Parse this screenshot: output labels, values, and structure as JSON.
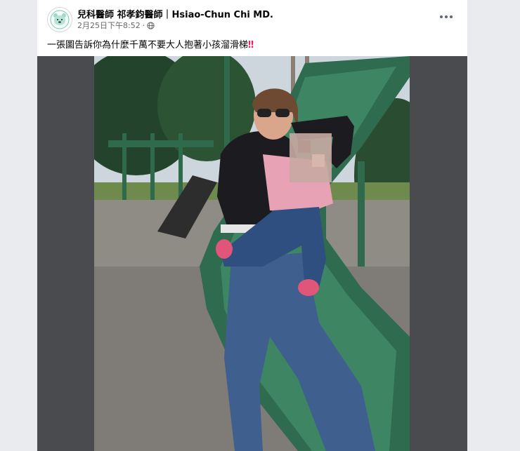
{
  "post": {
    "author": "兒科醫師 祁孝鈞醫師｜Hsiao-Chun Chi MD.",
    "timestamp": "2月25日下午8:52",
    "privacy_separator": "·",
    "audience_icon": "globe-icon",
    "more_icon": "more-options-icon",
    "caption": "一張圖告訴你為什麼千萬不要大人抱著小孩溜滑梯",
    "caption_emoji": "‼",
    "avatar_icon": "bear-avatar-icon",
    "photo_icon": "post-photo"
  },
  "colors": {
    "page_bg": "#e9ebee",
    "card_bg": "#ffffff",
    "media_bg": "#4a4b4f",
    "slide_green": "#2e6b4f",
    "caption_emoji": "#e0245e"
  }
}
